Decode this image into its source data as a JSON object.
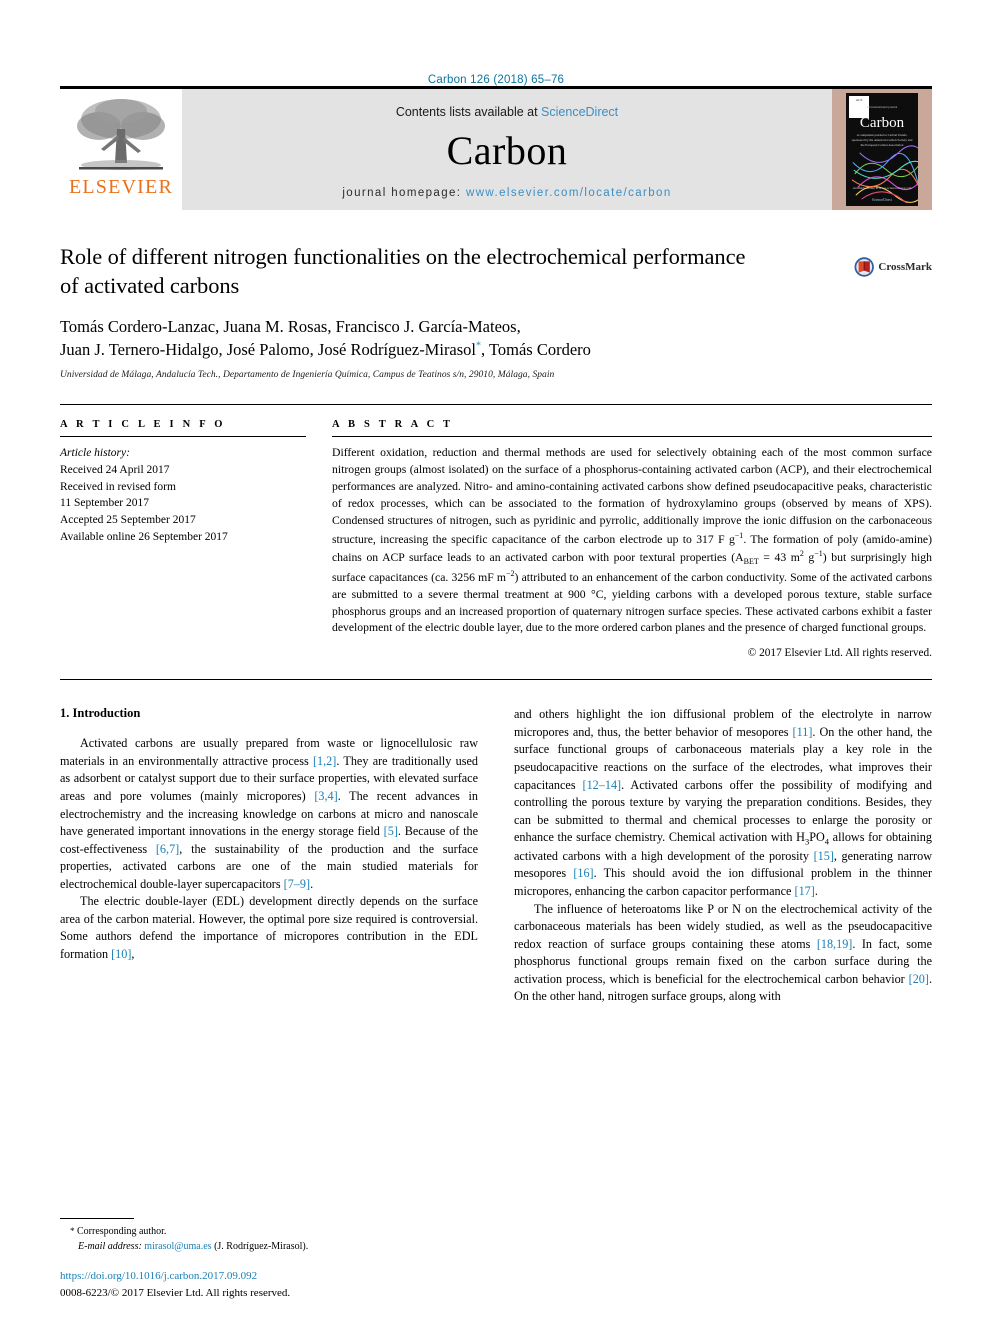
{
  "running_head": "Carbon 126 (2018) 65–76",
  "masthead": {
    "elsevier_wordmark": "ELSEVIER",
    "contents_prefix": "Contents lists available at ",
    "contents_link": "ScienceDirect",
    "journal_name": "Carbon",
    "homepage_prefix": "journal homepage: ",
    "homepage_url": "www.elsevier.com/locate/carbon",
    "cover": {
      "title": "Carbon",
      "eyebrow": "An international journal",
      "subtitle": "A companion journal to Carbon Trends, sponsored by the American Carbon Society and the European Carbon Association",
      "footer": "Available online at www.sciencedirect.com",
      "footer2": "ScienceDirect"
    }
  },
  "article": {
    "title": "Role of different nitrogen functionalities on the electrochemical performance of activated carbons",
    "authors_line1": "Tomás Cordero-Lanzac, Juana M. Rosas, Francisco J. García-Mateos,",
    "authors_line2_a": "Juan J. Ternero-Hidalgo, José Palomo, José Rodríguez-Mirasol",
    "authors_corresponding_marker": "*",
    "authors_line2_b": ", Tomás Cordero",
    "affiliation": "Universidad de Málaga, Andalucía Tech., Departamento de Ingeniería Química, Campus de Teatinos s/n, 29010, Málaga, Spain",
    "crossmark_label": "CrossMark"
  },
  "article_info": {
    "heading": "A R T I C L E   I N F O",
    "history_label": "Article history:",
    "history": [
      "Received 24 April 2017",
      "Received in revised form",
      "11 September 2017",
      "Accepted 25 September 2017",
      "Available online 26 September 2017"
    ]
  },
  "abstract": {
    "heading": "A B S T R A C T",
    "paragraphs": [
      "Different oxidation, reduction and thermal methods are used for selectively obtaining each of the most common surface nitrogen groups (almost isolated) on the surface of a phosphorus-containing activated carbon (ACP), and their electrochemical performances are analyzed. Nitro- and amino-containing activated carbons show defined pseudocapacitive peaks, characteristic of redox processes, which can be associated to the formation of hydroxylamino groups (observed by means of XPS). Condensed structures of nitrogen, such as pyridinic and pyrrolic, additionally improve the ionic diffusion on the carbonaceous structure, increasing the specific capacitance of the carbon electrode up to 317 F g"
    ],
    "frag_after_317": ". The formation of poly (amido-amine) chains on ACP surface leads to an activated carbon with poor textural properties (A",
    "frag_bet": "BET",
    "frag_bet_eq": " = 43 m",
    "frag_m2": "2",
    "frag_g": " g",
    "frag_g1": "−1",
    "frag_after_bet": ") but surprisingly high surface capacitances (ca. 3256 mF m",
    "frag_mf": "−2",
    "frag_tail": ") attributed to an enhancement of the carbon conductivity. Some of the activated carbons are submitted to a severe thermal treatment at 900 °C, yielding carbons with a developed porous texture, stable surface phosphorus groups and an increased proportion of quaternary nitrogen surface species. These activated carbons exhibit a faster development of the electric double layer, due to the more ordered carbon planes and the presence of charged functional groups.",
    "superscript_317": "−1",
    "copyright": "© 2017 Elsevier Ltd. All rights reserved."
  },
  "body": {
    "section_heading": "1.  Introduction",
    "left": {
      "p1_a": "Activated carbons are usually prepared from waste or lignocellulosic raw materials in an environmentally attractive process ",
      "p1_c1": "[1,2]",
      "p1_b": ". They are traditionally used as adsorbent or catalyst support due to their surface properties, with elevated surface areas and pore volumes (mainly micropores) ",
      "p1_c2": "[3,4]",
      "p1_c": ". The recent advances in electrochemistry and the increasing knowledge on carbons at micro and nanoscale have generated important innovations in the energy storage field ",
      "p1_c3": "[5]",
      "p1_d": ". Because of the cost-effectiveness ",
      "p1_c4": "[6,7]",
      "p1_e": ", the sustainability of the production and the surface properties, activated carbons are one of the main studied materials for electrochemical double-layer supercapacitors ",
      "p1_c5": "[7–9]",
      "p1_f": ".",
      "p2_a": "The electric double-layer (EDL) development directly depends on the surface area of the carbon material. However, the optimal pore size required is controversial. Some authors defend the importance of micropores contribution in the EDL formation ",
      "p2_c1": "[10]",
      "p2_b": ","
    },
    "right": {
      "p1_a": "and others highlight the ion diffusional problem of the electrolyte in narrow micropores and, thus, the better behavior of mesopores ",
      "p1_c1": "[11]",
      "p1_b": ". On the other hand, the surface functional groups of carbonaceous materials play a key role in the pseudocapacitive reactions on the surface of the electrodes, what improves their capacitances ",
      "p1_c2": "[12–14]",
      "p1_c": ". Activated carbons offer the possibility of modifying and controlling the porous texture by varying the preparation conditions. Besides, they can be submitted to thermal and chemical processes to enlarge the porosity or enhance the surface chemistry. Chemical activation with H",
      "p1_sub3": "3",
      "p1_po": "PO",
      "p1_sub4": "4",
      "p1_d": " allows for obtaining activated carbons with a high development of the porosity ",
      "p1_c3": "[15]",
      "p1_e": ", generating narrow mesopores ",
      "p1_c4": "[16]",
      "p1_f": ". This should avoid the ion diffusional problem in the thinner micropores, enhancing the carbon capacitor performance ",
      "p1_c5": "[17]",
      "p1_g": ".",
      "p2_a": "The influence of heteroatoms like P or N on the electrochemical activity of the carbonaceous materials has been widely studied, as well as the pseudocapacitive redox reaction of surface groups containing these atoms ",
      "p2_c1": "[18,19]",
      "p2_b": ". In fact, some phosphorus functional groups remain fixed on the carbon surface during the activation process, which is beneficial for the electrochemical carbon behavior ",
      "p2_c2": "[20]",
      "p2_c": ". On the other hand, nitrogen surface groups, along with"
    }
  },
  "footer": {
    "corresponding_marker": "*",
    "corresponding_label": " Corresponding author.",
    "email_label": "E-mail address:",
    "email": "mirasol@uma.es",
    "email_suffix": " (J. Rodríguez-Mirasol).",
    "doi": "https://doi.org/10.1016/j.carbon.2017.09.092",
    "issn": "0008-6223/© 2017 Elsevier Ltd. All rights reserved."
  },
  "colors": {
    "link": "#1a7fb5",
    "elsevier_orange": "#e9711c",
    "masthead_bg": "#e3e3e3"
  }
}
